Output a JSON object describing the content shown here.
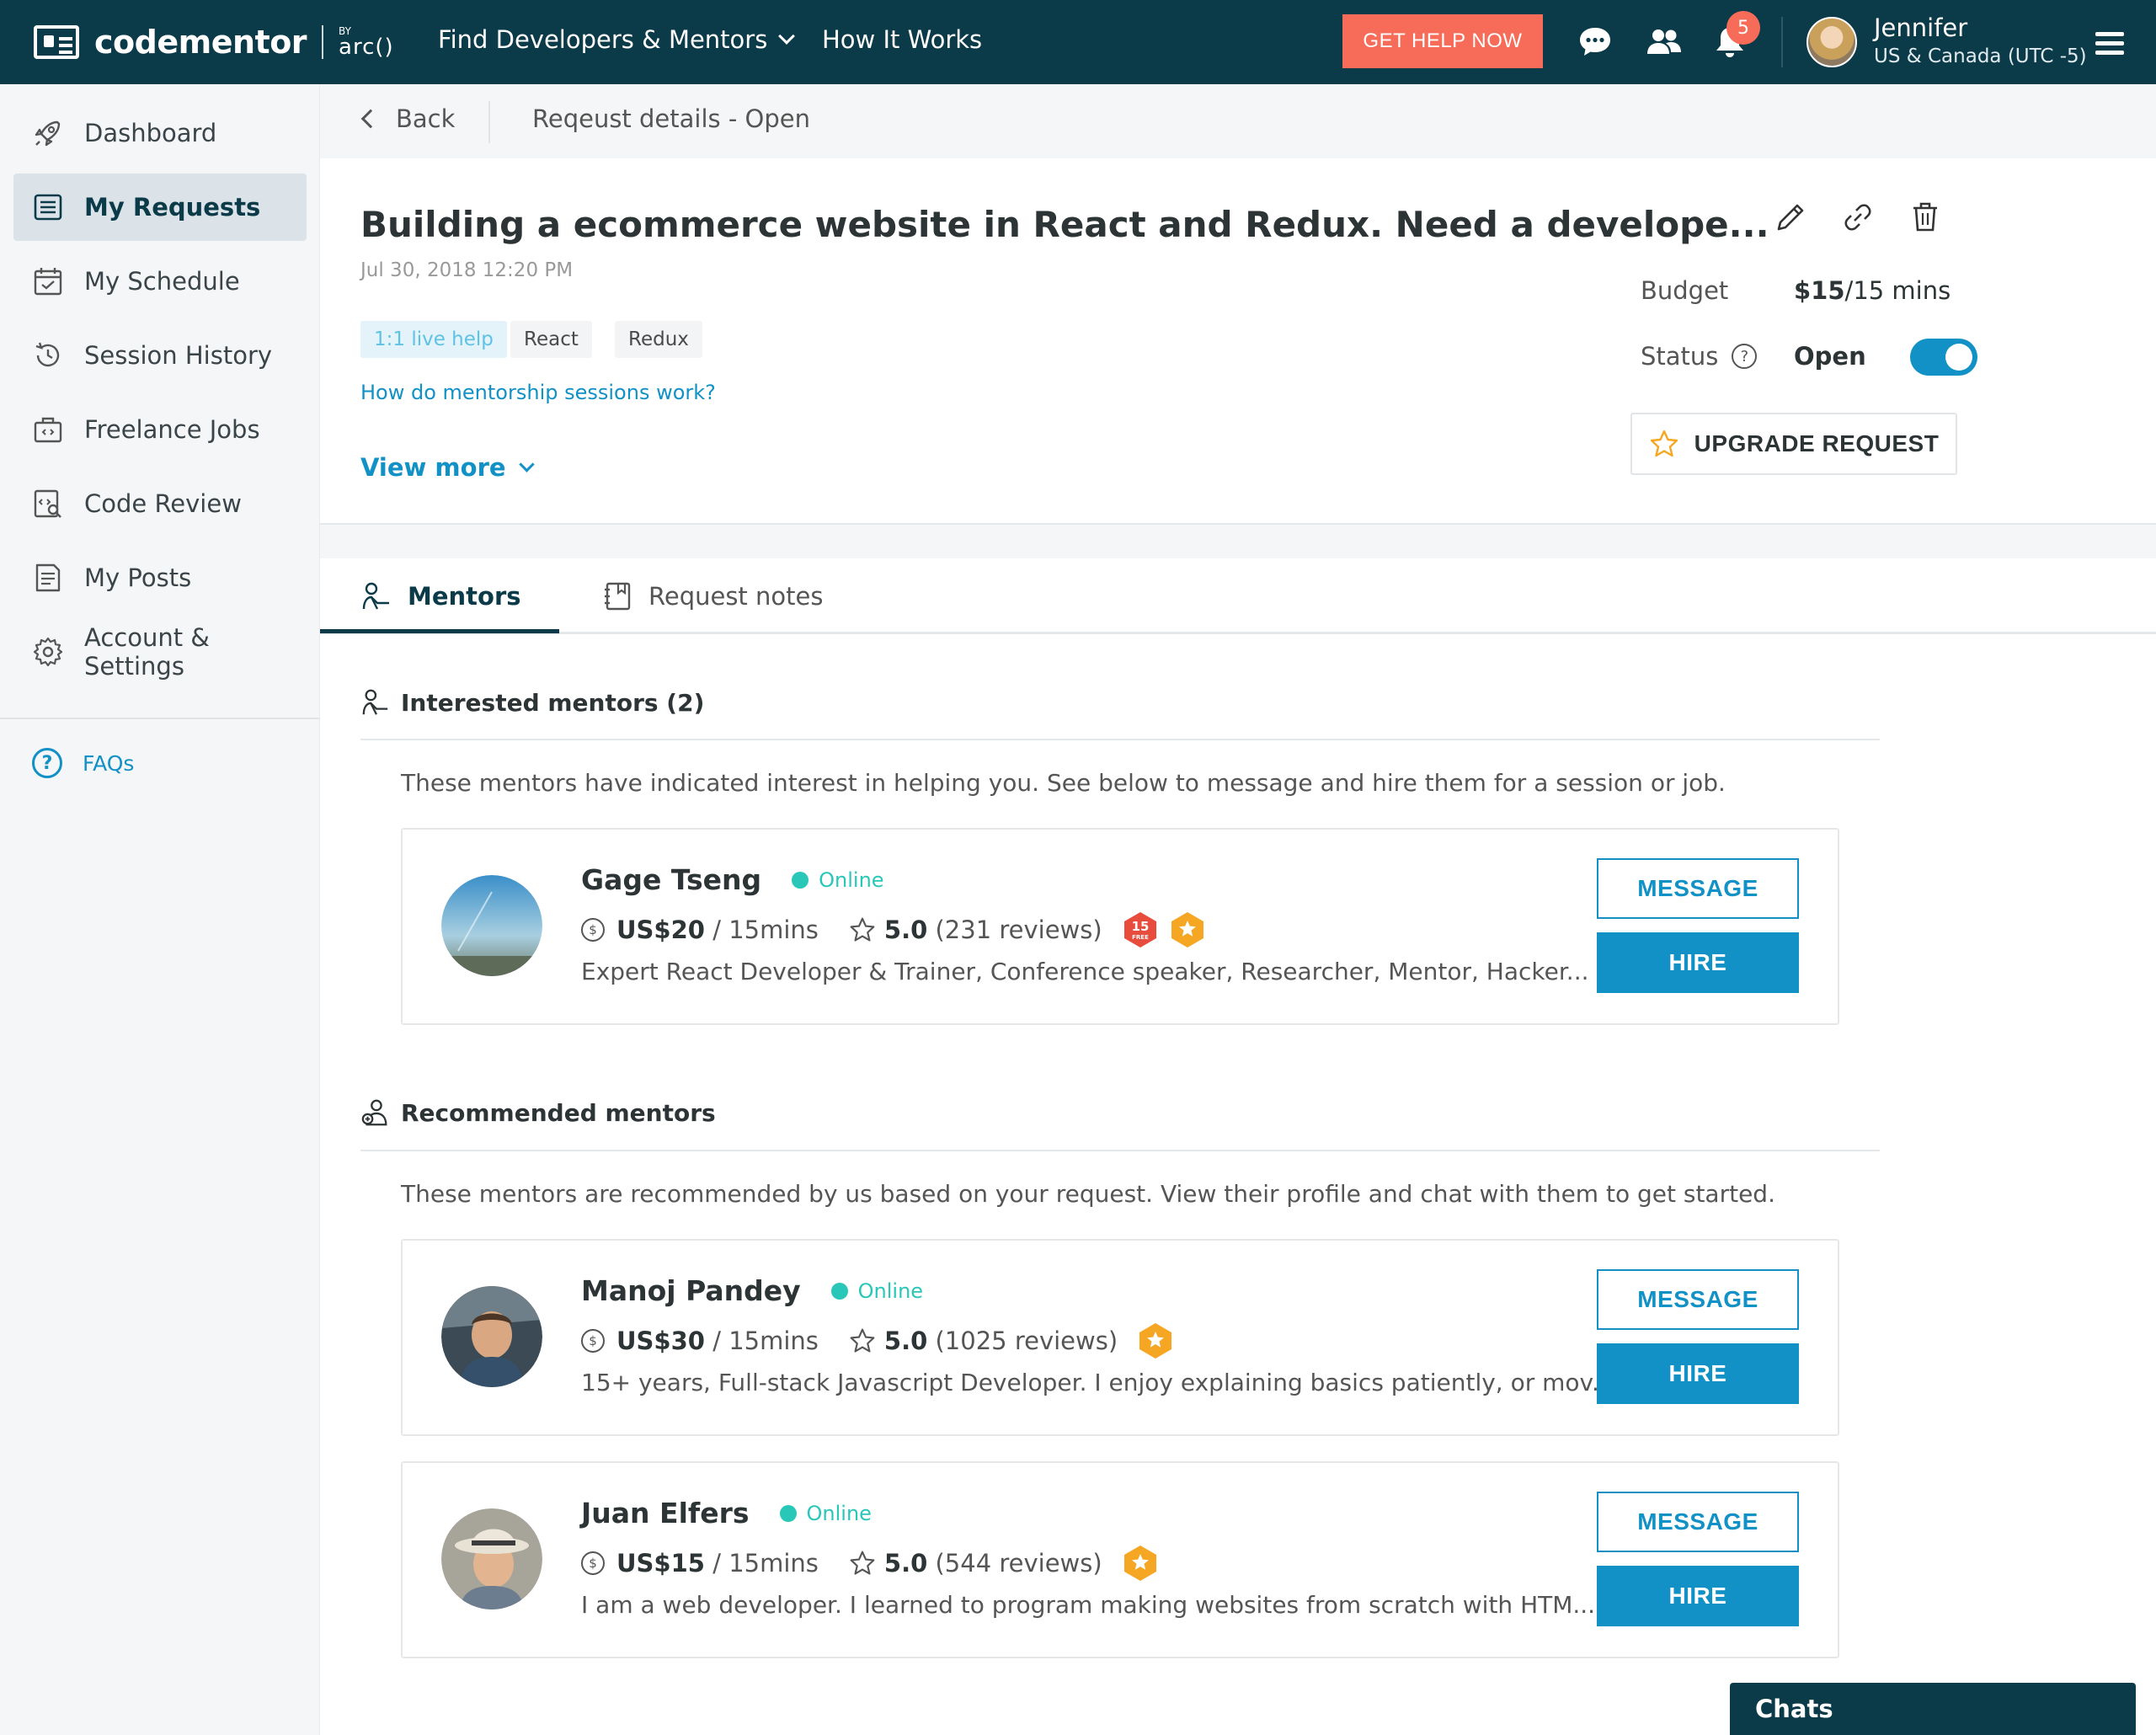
{
  "nav": {
    "logo_text": "codementor",
    "logo_by": "BY",
    "logo_arc": "arc()",
    "links": [
      {
        "label": "Find Developers & Mentors"
      },
      {
        "label": "How It Works"
      }
    ],
    "cta": "GET HELP NOW",
    "notification_count": "5",
    "user_name": "Jennifer",
    "user_timezone": "US & Canada (UTC -5)",
    "icons": [
      "chat-bubble-icon",
      "people-icon",
      "bell-icon",
      "hamburger-menu-icon"
    ]
  },
  "sidebar": {
    "items": [
      {
        "label": "Dashboard",
        "icon": "rocket-icon"
      },
      {
        "label": "My Requests",
        "icon": "requests-icon"
      },
      {
        "label": "My Schedule",
        "icon": "calendar-icon"
      },
      {
        "label": "Session History",
        "icon": "history-icon"
      },
      {
        "label": "Freelance Jobs",
        "icon": "briefcase-icon"
      },
      {
        "label": "Code Review",
        "icon": "code-review-icon"
      },
      {
        "label": "My Posts",
        "icon": "posts-icon"
      },
      {
        "label": "Account & Settings",
        "icon": "gear-icon"
      }
    ],
    "active": "My Requests",
    "faq_label": "FAQs"
  },
  "breadcrumb": {
    "back_label": "Back",
    "title": "Reqeust details - Open"
  },
  "request": {
    "title": "Building a ecommerce website in React and Redux. Need a develope...",
    "date": "Jul 30, 2018 12:20 PM",
    "tags": [
      "1:1 live help",
      "React",
      "Redux"
    ],
    "how_link": "How do mentorship sessions work?",
    "view_more": "View more",
    "budget_label": "Budget",
    "budget_amount": "$15",
    "budget_unit": "/15 mins",
    "status_label": "Status",
    "status_value": "Open",
    "status_on": true,
    "upgrade_label": "UPGRADE REQUEST",
    "actions": [
      "pencil-icon",
      "link-icon",
      "trash-icon"
    ]
  },
  "tabs": [
    {
      "label": "Mentors",
      "active": true
    },
    {
      "label": "Request notes",
      "active": false
    }
  ],
  "interested": {
    "heading": "Interested mentors (2)",
    "description": "These mentors have indicated interest in helping you. See below to message and hire them for a session or job.",
    "mentors": [
      {
        "name": "Gage Tseng",
        "status": "Online",
        "rate": "US$20",
        "rate_unit": "/ 15mins",
        "rating": "5.0",
        "reviews": "(231 reviews)",
        "free_badge_num": "15",
        "free_badge_txt": "FREE",
        "description": "Expert React Developer & Trainer, Conference speaker, Researcher, Mentor, Hacker...",
        "message_label": "MESSAGE",
        "hire_label": "HIRE"
      }
    ]
  },
  "recommended": {
    "heading": "Recommended mentors",
    "description": "These mentors are recommended by us based on your request. View their profile and chat with them to get started.",
    "mentors": [
      {
        "name": "Manoj Pandey",
        "status": "Online",
        "rate": "US$30",
        "rate_unit": "/ 15mins",
        "rating": "5.0",
        "reviews": "(1025 reviews)",
        "description": "15+ years, Full-stack Javascript Developer. I enjoy explaining basics patiently, or mov...",
        "message_label": "MESSAGE",
        "hire_label": "HIRE"
      },
      {
        "name": "Juan Elfers",
        "status": "Online",
        "rate": "US$15",
        "rate_unit": "/ 15mins",
        "rating": "5.0",
        "reviews": "(544 reviews)",
        "description": "I am a web developer. I learned to program making websites from scratch with HTM...",
        "message_label": "MESSAGE",
        "hire_label": "HIRE"
      }
    ]
  },
  "chats_label": "Chats",
  "colors": {
    "nav_bg": "#0b3a49",
    "accent": "#1191c5",
    "cta": "#f76b59",
    "online": "#29c7b8",
    "badge_gold": "#f5a623"
  }
}
